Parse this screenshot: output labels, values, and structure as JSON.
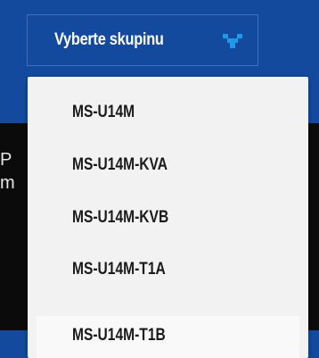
{
  "header": {
    "select_label": "Vyberte skupinu",
    "select_icon": "group-icon",
    "accent_color": "#144a9e",
    "icon_color": "#1e9be8"
  },
  "backdrop": {
    "text_line1": "P",
    "text_line2": "m"
  },
  "dropdown": {
    "items": [
      {
        "label": "MS-U14M"
      },
      {
        "label": "MS-U14M-KVA"
      },
      {
        "label": "MS-U14M-KVB"
      },
      {
        "label": "MS-U14M-T1A"
      },
      {
        "label": "MS-U14M-T1B"
      }
    ]
  }
}
